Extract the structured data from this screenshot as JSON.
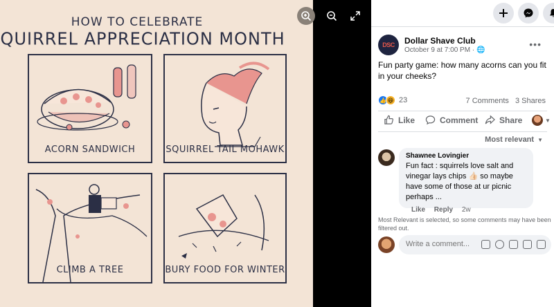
{
  "poster": {
    "title_line1": "HOW TO CELEBRATE",
    "title_line2": "SQUIRREL APPRECIATION MONTH",
    "panels": [
      {
        "caption": "ACORN SANDWICH"
      },
      {
        "caption": "SQUIRREL TAIL MOHAWK"
      },
      {
        "caption": "CLIMB A TREE"
      },
      {
        "caption": "BURY FOOD FOR WINTER"
      }
    ],
    "colors": {
      "background": "#f3e4d6",
      "ink": "#2b2f45",
      "accent": "#e8958f"
    }
  },
  "media_controls": {
    "zoom_in_icon": "zoom-in-icon",
    "zoom_out_icon": "zoom-out-icon",
    "fullscreen_icon": "fullscreen-icon"
  },
  "topbar": {
    "buttons": [
      "plus-icon",
      "messenger-icon",
      "bell-icon"
    ]
  },
  "post": {
    "page_name": "Dollar Shave Club",
    "avatar_text": "DSC",
    "date": "October 9 at 7:00 PM · ",
    "text": "Fun party game: how many acorns can you fit in your cheeks?",
    "reaction_count": "23",
    "comments_count": "7 Comments",
    "shares_count": "3 Shares",
    "actions": {
      "like": "Like",
      "comment": "Comment",
      "share": "Share"
    }
  },
  "comments": {
    "sort_label": "Most relevant",
    "items": [
      {
        "author": "Shawnee Lovingier",
        "text": "Fun fact : squirrels love salt and vinegar lays chips 👍🏻 so maybe have some of those at ur picnic perhaps ...",
        "like": "Like",
        "reply": "Reply",
        "time": "2w"
      }
    ],
    "filter_note": "Most Relevant is selected, so some comments may have been filtered out.",
    "write_placeholder": "Write a comment..."
  }
}
